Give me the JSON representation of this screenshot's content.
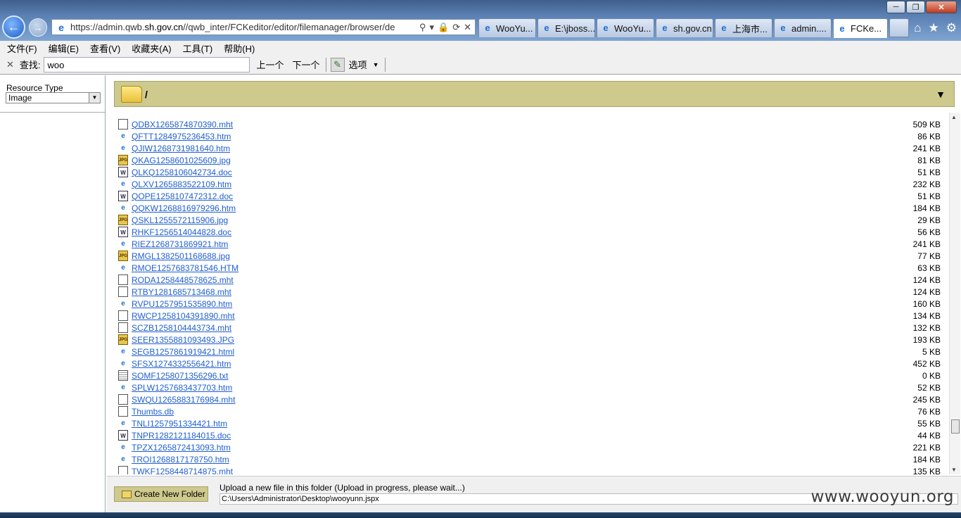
{
  "window": {
    "minimize_label": "─",
    "restore_label": "❐",
    "close_label": "✕"
  },
  "address_bar": {
    "url_prefix": "https://admin.qwb.",
    "url_domain": "sh.gov.cn",
    "url_suffix": "//qwb_inter/FCKeditor/editor/filemanager/browser/de",
    "search_icon": "⚲",
    "lock_icon": "🔒",
    "refresh_icon": "⟳",
    "stop_icon": "✕"
  },
  "tabs": [
    {
      "label": "WooYu...",
      "icon": "e"
    },
    {
      "label": "E:\\jboss...",
      "icon": "e"
    },
    {
      "label": "WooYu...",
      "icon": "e"
    },
    {
      "label": "sh.gov.cn",
      "icon": "e"
    },
    {
      "label": "上海市...",
      "icon": "e"
    },
    {
      "label": "admin....",
      "icon": "e"
    },
    {
      "label": "FCKe...",
      "icon": "e",
      "active": true
    }
  ],
  "menu": [
    "文件(F)",
    "编辑(E)",
    "查看(V)",
    "收藏夹(A)",
    "工具(T)",
    "帮助(H)"
  ],
  "findbar": {
    "label": "查找:",
    "value": "woo",
    "prev": "上一个",
    "next": "下一个",
    "options": "选项"
  },
  "sidebar": {
    "resource_type_label": "Resource Type",
    "resource_type_value": "Image"
  },
  "folder": {
    "current_path": "/"
  },
  "files": [
    {
      "name": "QDBX1265874870390.mht",
      "size": "509 KB",
      "type": "blank"
    },
    {
      "name": "QFTT1284975236453.htm",
      "size": "86 KB",
      "type": "ie"
    },
    {
      "name": "QJIW1268731981640.htm",
      "size": "241 KB",
      "type": "ie"
    },
    {
      "name": "QKAG1258601025609.jpg",
      "size": "81 KB",
      "type": "jpg"
    },
    {
      "name": "QLKQ1258106042734.doc",
      "size": "51 KB",
      "type": "doc"
    },
    {
      "name": "QLXV1265883522109.htm",
      "size": "232 KB",
      "type": "ie"
    },
    {
      "name": "QOPE1258107472312.doc",
      "size": "51 KB",
      "type": "doc"
    },
    {
      "name": "QQKW1268816979296.htm",
      "size": "184 KB",
      "type": "ie"
    },
    {
      "name": "QSKL1255572115906.jpg",
      "size": "29 KB",
      "type": "jpg"
    },
    {
      "name": "RHKF1256514044828.doc",
      "size": "56 KB",
      "type": "doc"
    },
    {
      "name": "RIEZ1268731869921.htm",
      "size": "241 KB",
      "type": "ie"
    },
    {
      "name": "RMGL1382501168688.jpg",
      "size": "77 KB",
      "type": "jpg"
    },
    {
      "name": "RMOE1257683781546.HTM",
      "size": "63 KB",
      "type": "ie"
    },
    {
      "name": "RODA1258448578625.mht",
      "size": "124 KB",
      "type": "blank"
    },
    {
      "name": "RTBY1281685713468.mht",
      "size": "124 KB",
      "type": "blank"
    },
    {
      "name": "RVPU1257951535890.htm",
      "size": "160 KB",
      "type": "ie"
    },
    {
      "name": "RWCP1258104391890.mht",
      "size": "134 KB",
      "type": "blank"
    },
    {
      "name": "SCZB1258104443734.mht",
      "size": "132 KB",
      "type": "blank"
    },
    {
      "name": "SEER1355881093493.JPG",
      "size": "193 KB",
      "type": "jpg"
    },
    {
      "name": "SEGB1257861919421.html",
      "size": "5 KB",
      "type": "ie"
    },
    {
      "name": "SFSX1274332556421.htm",
      "size": "452 KB",
      "type": "ie"
    },
    {
      "name": "SOMF1258071356296.txt",
      "size": "0 KB",
      "type": "txt"
    },
    {
      "name": "SPLW1257683437703.htm",
      "size": "52 KB",
      "type": "ie"
    },
    {
      "name": "SWQU1265883176984.mht",
      "size": "245 KB",
      "type": "blank"
    },
    {
      "name": "Thumbs.db",
      "size": "76 KB",
      "type": "blank"
    },
    {
      "name": "TNLI1257951334421.htm",
      "size": "55 KB",
      "type": "ie"
    },
    {
      "name": "TNPR1282121184015.doc",
      "size": "44 KB",
      "type": "doc"
    },
    {
      "name": "TPZX1265872413093.htm",
      "size": "221 KB",
      "type": "ie"
    },
    {
      "name": "TROI1268817178750.htm",
      "size": "184 KB",
      "type": "ie"
    },
    {
      "name": "TWKF1258448714875.mht",
      "size": "135 KB",
      "type": "blank"
    }
  ],
  "bottom": {
    "new_folder_label": "Create New Folder",
    "upload_label": "Upload a new file in this folder (Upload in progress, please wait...)",
    "upload_file": "C:\\Users\\Administrator\\Desktop\\wooyunn.jspx"
  },
  "watermark": "www.wooyun.org",
  "colors": {
    "link": "#1f5fd0",
    "folder_bar": "#cec98d",
    "chrome": "#5c82b5"
  }
}
